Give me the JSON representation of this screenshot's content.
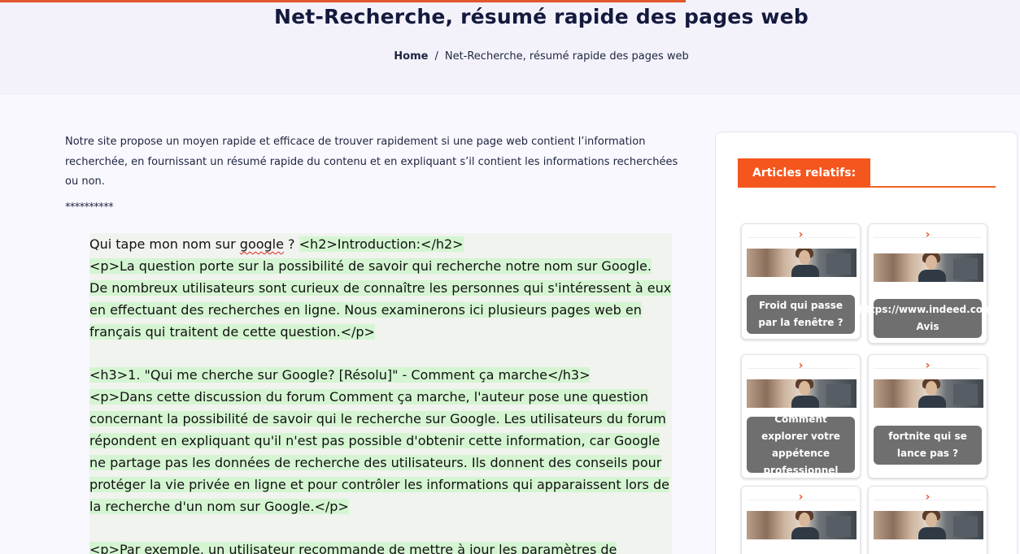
{
  "page": {
    "title": "Net-Recherche, résumé rapide des pages web"
  },
  "breadcrumb": {
    "home": "Home",
    "separator": "/",
    "current": "Net-Recherche, résumé rapide des pages web"
  },
  "intro": {
    "text": "Notre site propose un moyen rapide et efficace de trouver rapidement si une page web contient l’information recherchée, en fournissant un résumé rapide du contenu et en expliquant s’il contient les informations recherchées ou non.",
    "stars": "**********"
  },
  "article": {
    "query_prefix": "Qui tape mon nom sur ",
    "query_word": "google",
    "query_suffix": " ? ",
    "h2_intro": "<h2>Introduction:</h2>",
    "p1": "<p>La question porte sur la possibilité de savoir qui recherche notre nom sur Google. De nombreux utilisateurs sont curieux de connaître les personnes qui s'intéressent à eux en effectuant des recherches en ligne. Nous examinerons ici plusieurs pages web en français qui traitent de cette question.</p>",
    "h3_1": "<h3>1. \"Qui me cherche sur Google? [Résolu]\" - Comment ça marche</h3>",
    "p2": "<p>Dans cette discussion du forum Comment ça marche, l'auteur pose une question concernant la possibilité de savoir qui le recherche sur Google. Les utilisateurs du forum répondent en expliquant qu'il n'est pas possible d'obtenir cette information, car Google ne partage pas les données de recherche des utilisateurs. Ils donnent des conseils pour protéger la vie privée en ligne et pour contrôler les informations qui apparaissent lors de la recherche d'un nom sur Google.</p>",
    "p3": "<p>Par exemple, un utilisateur recommande de mettre à jour les paramètres de"
  },
  "sidebar": {
    "heading": "Articles relatifs:",
    "chevron": "›",
    "cards": [
      {
        "caption": "Froid qui passe par la fenêtre ?"
      },
      {
        "caption": "https://www.indeed.com: Avis"
      },
      {
        "caption": "Comment explorer votre appétence professionnel"
      },
      {
        "caption": "fortnite qui se lance pas ?"
      },
      {
        "caption": ""
      },
      {
        "caption": ""
      }
    ]
  },
  "colors": {
    "accent": "#f5561d",
    "highlight": "#d5f5d2",
    "caption_bg": "#6f6f6f"
  }
}
